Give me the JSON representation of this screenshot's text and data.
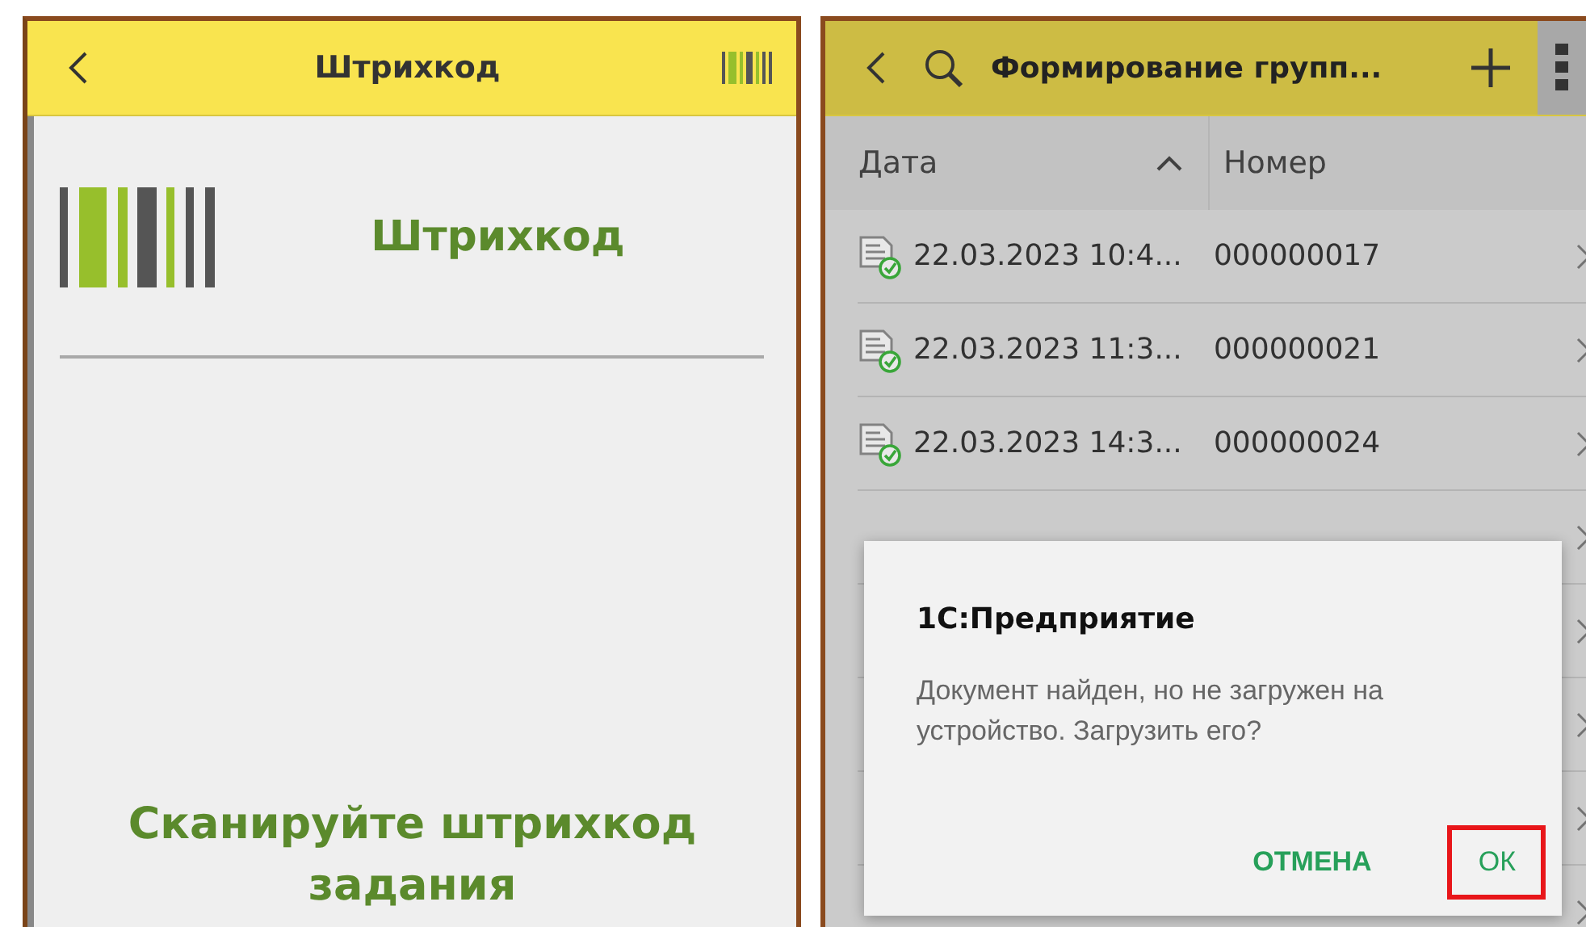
{
  "left_screen": {
    "header": {
      "title": "Штрихкод"
    },
    "heading": "Штрихкод",
    "prompt": "Сканируйте штрихкод задания"
  },
  "right_screen": {
    "header": {
      "title": "Формирование групп..."
    },
    "table": {
      "columns": [
        {
          "label": "Дата",
          "sorted": true
        },
        {
          "label": "Номер",
          "sorted": false
        }
      ],
      "rows": [
        {
          "date": "22.03.2023 10:4...",
          "number": "000000017",
          "covered": false
        },
        {
          "date": "22.03.2023 11:3...",
          "number": "000000021",
          "covered": false
        },
        {
          "date": "22.03.2023 14:3...",
          "number": "000000024",
          "covered": false
        },
        {
          "covered": true
        },
        {
          "covered": true
        },
        {
          "covered": true
        },
        {
          "covered": true
        },
        {
          "covered": true
        }
      ]
    },
    "dialog": {
      "title": "1С:Предприятие",
      "message": "Документ найден, но не загружен на устройство. Загрузить его?",
      "buttons": [
        {
          "label": "ОТМЕНА",
          "highlighted": false
        },
        {
          "label": "ОК",
          "highlighted": true
        }
      ]
    }
  }
}
